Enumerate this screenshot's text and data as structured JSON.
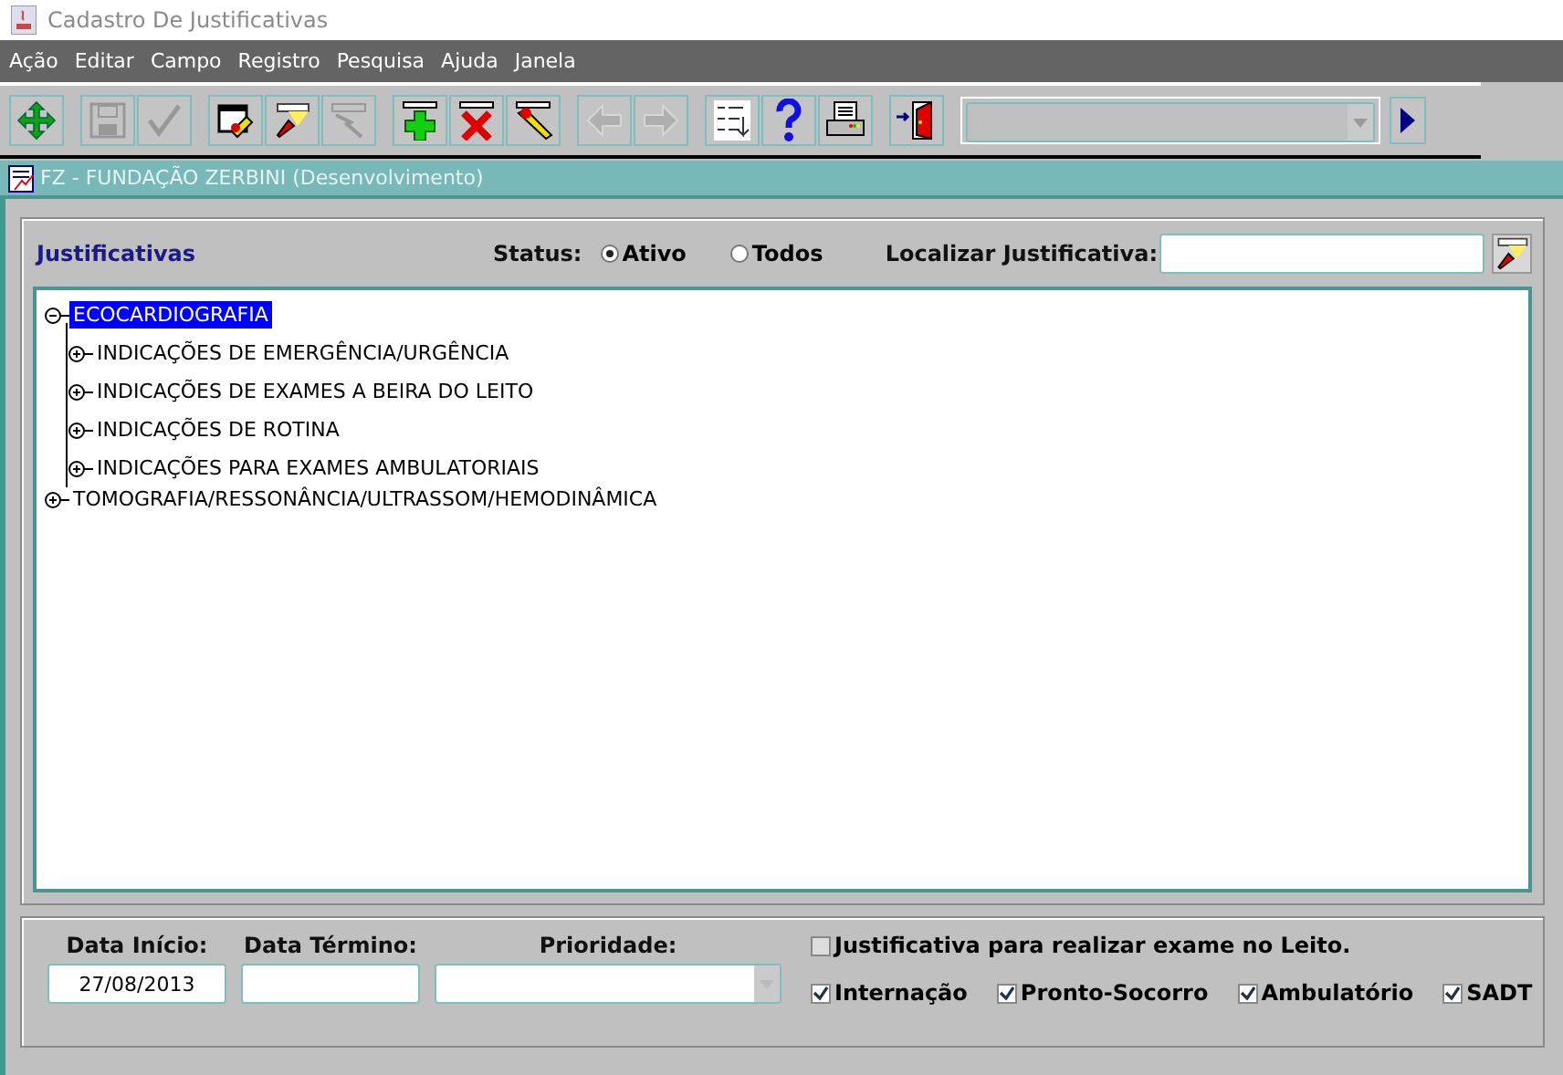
{
  "window": {
    "title": "Cadastro De Justificativas"
  },
  "menu": [
    "Ação",
    "Editar",
    "Campo",
    "Registro",
    "Pesquisa",
    "Ajuda",
    "Janela"
  ],
  "toolbar_groups": [
    [
      {
        "kind": "move",
        "disabled": false
      }
    ],
    [
      {
        "kind": "save",
        "disabled": true
      },
      {
        "kind": "check",
        "disabled": true
      }
    ],
    [
      {
        "kind": "form",
        "disabled": false
      },
      {
        "kind": "query",
        "disabled": false
      },
      {
        "kind": "execute",
        "disabled": true
      }
    ],
    [
      {
        "kind": "add",
        "disabled": false
      },
      {
        "kind": "delete",
        "disabled": false
      },
      {
        "kind": "edit",
        "disabled": false
      }
    ],
    [
      {
        "kind": "prev",
        "disabled": true
      },
      {
        "kind": "next",
        "disabled": true
      }
    ],
    [
      {
        "kind": "list",
        "disabled": false
      },
      {
        "kind": "help",
        "disabled": false
      },
      {
        "kind": "print",
        "disabled": false
      }
    ],
    [
      {
        "kind": "exit",
        "disabled": false
      }
    ]
  ],
  "inner_window": {
    "title": "FZ - FUNDAÇÃO ZERBINI (Desenvolvimento)"
  },
  "section_title": "Justificativas",
  "status": {
    "label": "Status:",
    "options": [
      {
        "label": "Ativo",
        "selected": true
      },
      {
        "label": "Todos",
        "selected": false
      }
    ]
  },
  "search": {
    "label": "Localizar Justificativa:"
  },
  "tree": [
    {
      "label": "ECOCARDIOGRAFIA",
      "expanded": true,
      "selected": true,
      "children": [
        {
          "label": "INDICAÇÕES DE EMERGÊNCIA/URGÊNCIA",
          "expanded": false,
          "selected": false
        },
        {
          "label": "INDICAÇÕES DE EXAMES A BEIRA DO LEITO",
          "expanded": false,
          "selected": false
        },
        {
          "label": "INDICAÇÕES DE ROTINA",
          "expanded": false,
          "selected": false
        },
        {
          "label": "INDICAÇÕES PARA EXAMES AMBULATORIAIS",
          "expanded": false,
          "selected": false
        }
      ]
    },
    {
      "label": "TOMOGRAFIA/RESSONÂNCIA/ULTRASSOM/HEMODINÂMICA",
      "expanded": false,
      "selected": false
    }
  ],
  "fields": [
    {
      "label": "Data Início:",
      "value": "27/08/2013",
      "kind": "text"
    },
    {
      "label": "Data Término:",
      "kind": "text"
    },
    {
      "label": "Prioridade:",
      "kind": "select"
    }
  ],
  "leito": {
    "label": "Justificativa para realizar exame no Leito.",
    "checked": false
  },
  "origins": [
    {
      "label": "Internação",
      "checked": true
    },
    {
      "label": "Pronto-Socorro",
      "checked": true
    },
    {
      "label": "Ambulatório",
      "checked": true
    },
    {
      "label": "SADT",
      "checked": true
    }
  ]
}
